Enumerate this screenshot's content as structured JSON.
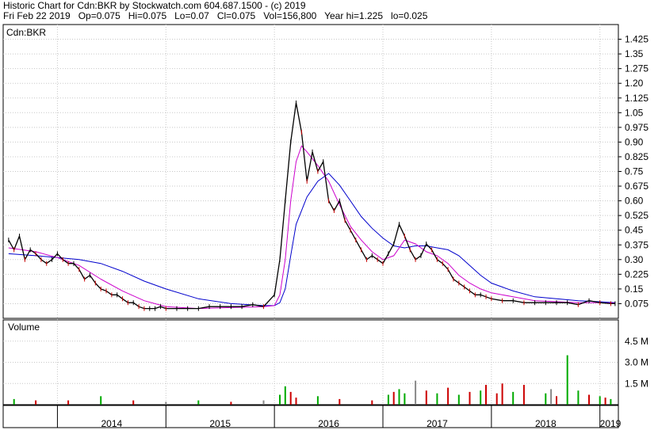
{
  "header": {
    "line1": "Historic Chart for Cdn:BKR by Stockwatch.com 604.687.1500 - (c) 2019",
    "line2": "Fri Feb 22 2019   Op=0.075   Hi=0.075   Lo=0.07   Cl=0.075   Vol=156,800   Year hi=1.225   lo=0.025"
  },
  "chart_data": [
    {
      "type": "line",
      "panel": "price",
      "title": "Cdn:BKR",
      "ylim": [
        0,
        1.5
      ],
      "y_ticks": [
        "1.425",
        "1.35",
        "1.275",
        "1.20",
        "1.125",
        "1.05",
        "0.975",
        "0.90",
        "0.825",
        "0.75",
        "0.675",
        "0.60",
        "0.525",
        "0.45",
        "0.375",
        "0.30",
        "0.225",
        "0.15",
        "0.075"
      ],
      "x_labels": [
        "2014",
        "2015",
        "2016",
        "2017",
        "2018",
        "2019"
      ],
      "grid": true,
      "colors": {
        "price": "#000000",
        "ma_short": "#cc00cc",
        "ma_long": "#0000cc",
        "down_day": "#cc0000"
      },
      "series": [
        {
          "role": "price",
          "x": [
            2013.55,
            2013.6,
            2013.65,
            2013.7,
            2013.75,
            2013.8,
            2013.85,
            2013.9,
            2013.95,
            2014.0,
            2014.05,
            2014.1,
            2014.15,
            2014.2,
            2014.25,
            2014.3,
            2014.35,
            2014.4,
            2014.45,
            2014.5,
            2014.55,
            2014.6,
            2014.65,
            2014.7,
            2014.75,
            2014.8,
            2014.85,
            2014.9,
            2014.95,
            2015.0,
            2015.1,
            2015.2,
            2015.3,
            2015.4,
            2015.5,
            2015.6,
            2015.7,
            2015.8,
            2015.9,
            2016.0,
            2016.05,
            2016.1,
            2016.15,
            2016.2,
            2016.25,
            2016.3,
            2016.35,
            2016.4,
            2016.45,
            2016.5,
            2016.55,
            2016.6,
            2016.65,
            2016.7,
            2016.75,
            2016.8,
            2016.85,
            2016.9,
            2016.95,
            2017.0,
            2017.05,
            2017.1,
            2017.15,
            2017.2,
            2017.25,
            2017.3,
            2017.35,
            2017.4,
            2017.45,
            2017.5,
            2017.55,
            2017.6,
            2017.65,
            2017.7,
            2017.75,
            2017.8,
            2017.85,
            2017.9,
            2017.95,
            2018.0,
            2018.1,
            2018.2,
            2018.3,
            2018.4,
            2018.5,
            2018.6,
            2018.7,
            2018.8,
            2018.9,
            2019.0,
            2019.1,
            2019.14
          ],
          "values": [
            0.4,
            0.35,
            0.42,
            0.3,
            0.35,
            0.33,
            0.3,
            0.28,
            0.3,
            0.33,
            0.3,
            0.28,
            0.28,
            0.25,
            0.2,
            0.22,
            0.18,
            0.15,
            0.14,
            0.12,
            0.12,
            0.1,
            0.08,
            0.08,
            0.06,
            0.05,
            0.05,
            0.05,
            0.06,
            0.05,
            0.05,
            0.05,
            0.05,
            0.06,
            0.06,
            0.06,
            0.06,
            0.07,
            0.06,
            0.12,
            0.3,
            0.6,
            0.9,
            1.1,
            0.95,
            0.7,
            0.85,
            0.75,
            0.8,
            0.6,
            0.55,
            0.6,
            0.5,
            0.45,
            0.4,
            0.35,
            0.3,
            0.32,
            0.3,
            0.28,
            0.33,
            0.38,
            0.48,
            0.42,
            0.35,
            0.3,
            0.32,
            0.38,
            0.35,
            0.3,
            0.28,
            0.25,
            0.2,
            0.18,
            0.16,
            0.14,
            0.12,
            0.12,
            0.11,
            0.1,
            0.09,
            0.09,
            0.08,
            0.08,
            0.08,
            0.08,
            0.08,
            0.07,
            0.09,
            0.08,
            0.075,
            0.075
          ]
        },
        {
          "role": "ma_short",
          "x": [
            2013.55,
            2013.8,
            2014.0,
            2014.2,
            2014.4,
            2014.6,
            2014.8,
            2015.0,
            2015.3,
            2015.6,
            2015.9,
            2016.0,
            2016.05,
            2016.1,
            2016.15,
            2016.2,
            2016.25,
            2016.3,
            2016.4,
            2016.5,
            2016.6,
            2016.7,
            2016.8,
            2016.9,
            2017.0,
            2017.1,
            2017.2,
            2017.3,
            2017.4,
            2017.5,
            2017.6,
            2017.7,
            2017.8,
            2017.9,
            2018.0,
            2018.2,
            2018.4,
            2018.6,
            2018.8,
            2019.0,
            2019.14
          ],
          "values": [
            0.36,
            0.34,
            0.31,
            0.27,
            0.2,
            0.14,
            0.09,
            0.06,
            0.05,
            0.055,
            0.06,
            0.065,
            0.12,
            0.3,
            0.6,
            0.8,
            0.88,
            0.85,
            0.78,
            0.7,
            0.58,
            0.47,
            0.4,
            0.34,
            0.3,
            0.32,
            0.4,
            0.38,
            0.34,
            0.32,
            0.28,
            0.22,
            0.18,
            0.15,
            0.13,
            0.11,
            0.09,
            0.085,
            0.08,
            0.08,
            0.078
          ]
        },
        {
          "role": "ma_long",
          "x": [
            2013.55,
            2013.8,
            2014.0,
            2014.2,
            2014.4,
            2014.6,
            2014.8,
            2015.0,
            2015.3,
            2015.6,
            2015.9,
            2016.0,
            2016.05,
            2016.1,
            2016.15,
            2016.2,
            2016.3,
            2016.4,
            2016.5,
            2016.6,
            2016.7,
            2016.8,
            2016.9,
            2017.0,
            2017.1,
            2017.2,
            2017.3,
            2017.4,
            2017.5,
            2017.6,
            2017.7,
            2017.8,
            2017.9,
            2018.0,
            2018.2,
            2018.4,
            2018.6,
            2018.8,
            2019.0,
            2019.14
          ],
          "values": [
            0.33,
            0.32,
            0.31,
            0.3,
            0.28,
            0.24,
            0.19,
            0.15,
            0.1,
            0.075,
            0.065,
            0.065,
            0.08,
            0.15,
            0.32,
            0.48,
            0.62,
            0.7,
            0.74,
            0.68,
            0.6,
            0.52,
            0.46,
            0.41,
            0.37,
            0.36,
            0.37,
            0.37,
            0.36,
            0.35,
            0.32,
            0.27,
            0.22,
            0.18,
            0.14,
            0.11,
            0.1,
            0.09,
            0.085,
            0.08
          ]
        }
      ]
    },
    {
      "type": "bar",
      "panel": "volume",
      "title": "Volume",
      "ylim": [
        0,
        6
      ],
      "y_ticks": [
        "4.5 M",
        "3.0 M",
        "1.5 M"
      ],
      "colors": {
        "up": "#00aa00",
        "down": "#cc0000",
        "flat": "#888888"
      },
      "x": [
        2013.6,
        2013.8,
        2014.1,
        2014.4,
        2014.7,
        2015.0,
        2015.3,
        2015.6,
        2015.9,
        2016.05,
        2016.1,
        2016.15,
        2016.2,
        2016.4,
        2016.6,
        2016.9,
        2017.05,
        2017.1,
        2017.15,
        2017.2,
        2017.3,
        2017.4,
        2017.5,
        2017.6,
        2017.7,
        2017.8,
        2017.9,
        2017.95,
        2018.05,
        2018.1,
        2018.2,
        2018.3,
        2018.5,
        2018.55,
        2018.6,
        2018.7,
        2018.8,
        2018.9,
        2019.0,
        2019.05,
        2019.1
      ],
      "values": [
        0.4,
        0.3,
        0.3,
        0.6,
        0.3,
        0.2,
        0.3,
        0.2,
        0.3,
        0.7,
        1.3,
        0.9,
        0.5,
        0.6,
        0.4,
        0.3,
        0.7,
        0.9,
        1.1,
        0.8,
        1.7,
        1.0,
        0.8,
        1.2,
        0.7,
        0.9,
        1.0,
        1.4,
        0.8,
        1.5,
        0.9,
        1.4,
        0.8,
        1.1,
        0.6,
        3.5,
        1.0,
        0.7,
        0.6,
        0.5,
        0.4
      ],
      "directions": [
        "up",
        "down",
        "down",
        "up",
        "down",
        "flat",
        "up",
        "down",
        "flat",
        "up",
        "up",
        "down",
        "down",
        "up",
        "down",
        "down",
        "up",
        "down",
        "up",
        "up",
        "flat",
        "down",
        "up",
        "down",
        "up",
        "down",
        "up",
        "down",
        "down",
        "down",
        "up",
        "down",
        "up",
        "flat",
        "down",
        "up",
        "up",
        "down",
        "up",
        "down",
        "up"
      ]
    }
  ]
}
